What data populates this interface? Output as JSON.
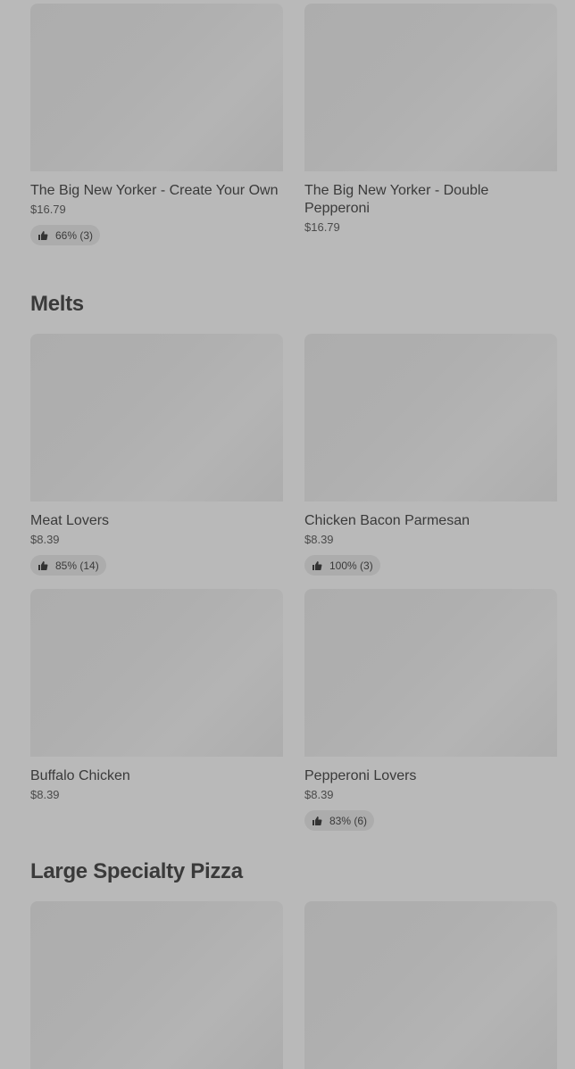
{
  "top_items": [
    {
      "name": "The Big New Yorker - Create Your Own",
      "price": "$16.79",
      "rating": "66% (3)"
    },
    {
      "name": "The Big New Yorker - Double Pepperoni",
      "price": "$16.79"
    }
  ],
  "sections": [
    {
      "title": "Melts",
      "items": [
        {
          "name": "Meat Lovers",
          "price": "$8.39",
          "rating": "85% (14)"
        },
        {
          "name": "Chicken Bacon Parmesan",
          "price": "$8.39",
          "rating": "100% (3)"
        },
        {
          "name": "Buffalo Chicken",
          "price": "$8.39"
        },
        {
          "name": "Pepperoni Lovers",
          "price": "$8.39",
          "rating": "83% (6)"
        }
      ]
    },
    {
      "title": "Large Specialty Pizza"
    }
  ],
  "icons": {
    "rating": "thumbs-up-icon"
  }
}
